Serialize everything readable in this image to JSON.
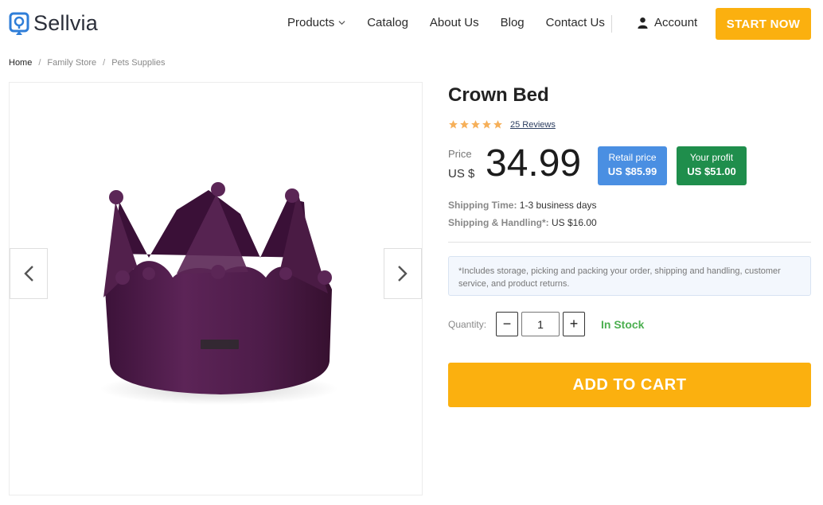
{
  "brand": {
    "name": "Sellvia",
    "accent": "#fbb00f",
    "logo_icon": "location-pin-icon"
  },
  "nav": {
    "items": [
      {
        "label": "Products",
        "has_dropdown": true
      },
      {
        "label": "Catalog"
      },
      {
        "label": "About Us"
      },
      {
        "label": "Blog"
      },
      {
        "label": "Contact Us"
      }
    ],
    "account_label": "Account",
    "cta_label": "START NOW"
  },
  "breadcrumb": [
    "Home",
    "Family Store",
    "Pets Supplies"
  ],
  "gallery": {
    "image_alt": "Crown Bed",
    "product_color": "#4a1b47",
    "prev_icon": "chevron-left-icon",
    "next_icon": "chevron-right-icon"
  },
  "product": {
    "title": "Crown Bed",
    "rating": 5,
    "reviews_label": "25 Reviews",
    "price_label": "Price",
    "currency": "US $",
    "price": "34.99",
    "retail_label": "Retail price",
    "retail_value": "US $85.99",
    "profit_label": "Your profit",
    "profit_value": "US $51.00",
    "shipping_time_label": "Shipping Time:",
    "shipping_time_value": "1-3 business days",
    "shipping_handling_label": "Shipping & Handling*:",
    "shipping_handling_value": "US $16.00",
    "note": "*Includes storage, picking and packing your order, shipping and handling, customer service, and product returns.",
    "quantity_label": "Quantity:",
    "quantity_value": "1",
    "qty_minus": "−",
    "qty_plus": "+",
    "stock_status": "In Stock",
    "add_to_cart_label": "ADD TO CART"
  },
  "colors": {
    "retail_badge": "#4a8fe2",
    "profit_badge": "#1f8e4c",
    "stock_green": "#4caf50",
    "star": "#f6b05a"
  }
}
